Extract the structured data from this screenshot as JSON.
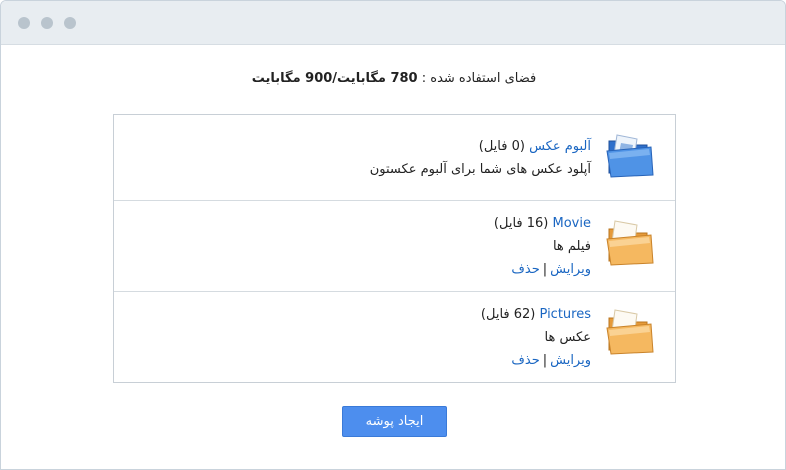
{
  "quota": {
    "label": "فضای استفاده شده :",
    "value": "780 مگابایت/900 مگابایت"
  },
  "albums": [
    {
      "name": "آلبوم عکس",
      "count": "(0 فایل)",
      "description": "آپلود عکس های شما برای آلبوم عکستون",
      "icon": "blue-folder-icon"
    },
    {
      "name": "Movie",
      "count": "(16 فایل)",
      "description": "فیلم ها",
      "edit_label": "ویرایش",
      "separator": "|",
      "delete_label": "حذف",
      "icon": "orange-folder-icon"
    },
    {
      "name": "Pictures",
      "count": "(62 فایل)",
      "description": "عکس ها",
      "edit_label": "ویرایش",
      "separator": "|",
      "delete_label": "حذف",
      "icon": "orange-folder-icon"
    }
  ],
  "create_button_label": "ایجاد پوشه",
  "colors": {
    "link": "#1a66c2",
    "button": "#4d8eee",
    "titlebar": "#e8edf1"
  }
}
